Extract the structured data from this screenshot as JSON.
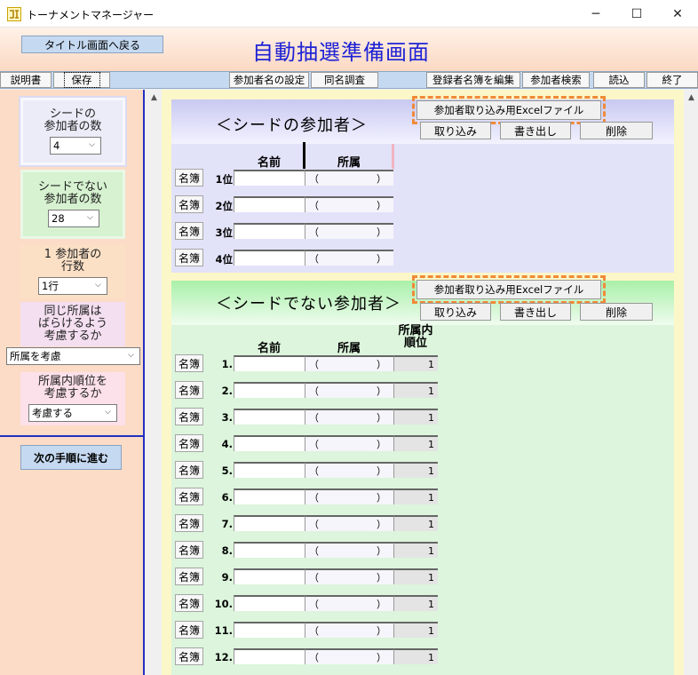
{
  "window": {
    "title": "トーナメントマネージャー",
    "controls": {
      "minimize": "─",
      "maximize": "☐",
      "close": "✕"
    }
  },
  "header": {
    "back_button": "タイトル画面へ戻る",
    "page_title": "自動抽選準備画面"
  },
  "toolbar": {
    "manual": "説明書",
    "save": "保存",
    "participant_name_settings": "参加者名の設定",
    "same_name_check": "同名調査",
    "edit_registry": "登録者名簿を編集",
    "search_participant": "参加者検索",
    "load": "読込",
    "exit": "終了"
  },
  "sidebar": {
    "seed_count_label": "シードの\n参加者の数",
    "seed_count_value": "4",
    "nonseed_count_label": "シードでない\n参加者の数",
    "nonseed_count_value": "28",
    "rows_label": "1 参加者の\n行数",
    "rows_value": "1行",
    "same_affil_label": "同じ所属は\nばらけるよう\n考慮するか",
    "same_affil_value": "所属を考慮",
    "affil_rank_label": "所属内順位を\n考慮するか",
    "affil_rank_value": "考慮する",
    "next_button": "次の手順に進む"
  },
  "seed_section": {
    "title": "＜シードの参加者＞",
    "excel_button": "参加者取り込み用Excelファイル",
    "import_button": "取り込み",
    "export_button": "書き出し",
    "delete_button": "削除",
    "col_name": "名前",
    "col_affil": "所属",
    "roster_button": "名簿",
    "affil_open": "（",
    "affil_close": "）",
    "rows": [
      {
        "rank": "1位"
      },
      {
        "rank": "2位"
      },
      {
        "rank": "3位"
      },
      {
        "rank": "4位"
      }
    ]
  },
  "nonseed_section": {
    "title": "＜シードでない参加者＞",
    "excel_button": "参加者取り込み用Excelファイル",
    "import_button": "取り込み",
    "export_button": "書き出し",
    "delete_button": "削除",
    "col_name": "名前",
    "col_affil": "所属",
    "col_order": "所属内\n順位",
    "roster_button": "名簿",
    "affil_open": "（",
    "affil_close": "）",
    "rows": [
      {
        "num": "1.",
        "order": "1"
      },
      {
        "num": "2.",
        "order": "1"
      },
      {
        "num": "3.",
        "order": "1"
      },
      {
        "num": "4.",
        "order": "1"
      },
      {
        "num": "5.",
        "order": "1"
      },
      {
        "num": "6.",
        "order": "1"
      },
      {
        "num": "7.",
        "order": "1"
      },
      {
        "num": "8.",
        "order": "1"
      },
      {
        "num": "9.",
        "order": "1"
      },
      {
        "num": "10.",
        "order": "1"
      },
      {
        "num": "11.",
        "order": "1"
      },
      {
        "num": "12.",
        "order": "1"
      }
    ]
  }
}
